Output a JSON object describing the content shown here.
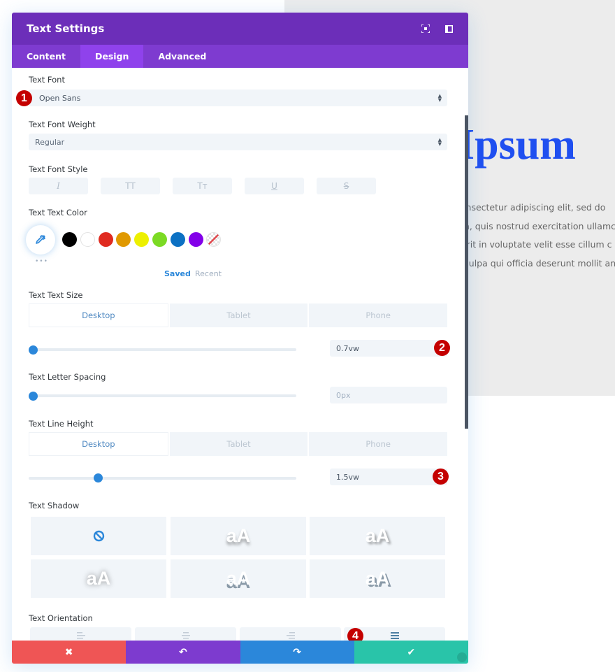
{
  "preview": {
    "heading": "n Ipsum",
    "body_lines": [
      "consectetur adipiscing elit, sed do",
      "am, quis nostrud exercitation ullamc",
      "derit in voluptate velit esse cillum c",
      "n culpa qui officia deserunt mollit an"
    ]
  },
  "modal": {
    "title": "Text Settings",
    "header_icons": [
      "fullscreen-icon",
      "sidebar-toggle-icon"
    ],
    "tabs": [
      {
        "label": "Content",
        "active": false
      },
      {
        "label": "Design",
        "active": true
      },
      {
        "label": "Advanced",
        "active": false
      }
    ]
  },
  "fields": {
    "text_font": {
      "label": "Text Font",
      "value": "Open Sans"
    },
    "text_font_weight": {
      "label": "Text Font Weight",
      "value": "Regular"
    },
    "text_font_style": {
      "label": "Text Font Style",
      "buttons": [
        {
          "name": "italic",
          "glyph": "I"
        },
        {
          "name": "uppercase",
          "glyph": "TT"
        },
        {
          "name": "capitalize",
          "glyph": "Tт"
        },
        {
          "name": "underline",
          "glyph": "U"
        },
        {
          "name": "strikethrough",
          "glyph": "S"
        }
      ]
    },
    "text_color": {
      "label": "Text Text Color",
      "swatches": [
        "#000000",
        "#ffffff",
        "#e02b20",
        "#e09900",
        "#edf000",
        "#7cda24",
        "#0c71c3",
        "#8300e9",
        "transparent"
      ],
      "saved_label": "Saved",
      "recent_label": "Recent",
      "more_label": "•••"
    },
    "text_size": {
      "label": "Text Text Size",
      "devices": [
        "Desktop",
        "Tablet",
        "Phone"
      ],
      "active_device": "Desktop",
      "value": "0.7vw",
      "slider_fraction": 0.0
    },
    "letter_spacing": {
      "label": "Text Letter Spacing",
      "value": "0px",
      "slider_fraction": 0.0
    },
    "line_height": {
      "label": "Text Line Height",
      "devices": [
        "Desktop",
        "Tablet",
        "Phone"
      ],
      "active_device": "Desktop",
      "value": "1.5vw",
      "slider_fraction": 0.25
    },
    "text_shadow": {
      "label": "Text Shadow",
      "none_icon": "no-shadow-icon",
      "preview_text": "aA"
    },
    "text_orientation": {
      "label": "Text Orientation",
      "options": [
        "left",
        "center",
        "right",
        "justified"
      ],
      "selected": "justified"
    }
  },
  "badges": [
    "1",
    "2",
    "3",
    "4"
  ],
  "footer": {
    "buttons": [
      {
        "name": "discard",
        "glyph": "✖",
        "color": "#ef5555"
      },
      {
        "name": "undo",
        "glyph": "↶",
        "color": "#7d3bcf"
      },
      {
        "name": "redo",
        "glyph": "↷",
        "color": "#2b87da"
      },
      {
        "name": "save",
        "glyph": "✔",
        "color": "#29c4a9"
      }
    ]
  },
  "colors": {
    "header": "#6c2eb9",
    "tabs": "#7e3bd0",
    "tab_active": "#8f42ec",
    "accent": "#2b87da",
    "badge": "#c40000"
  }
}
